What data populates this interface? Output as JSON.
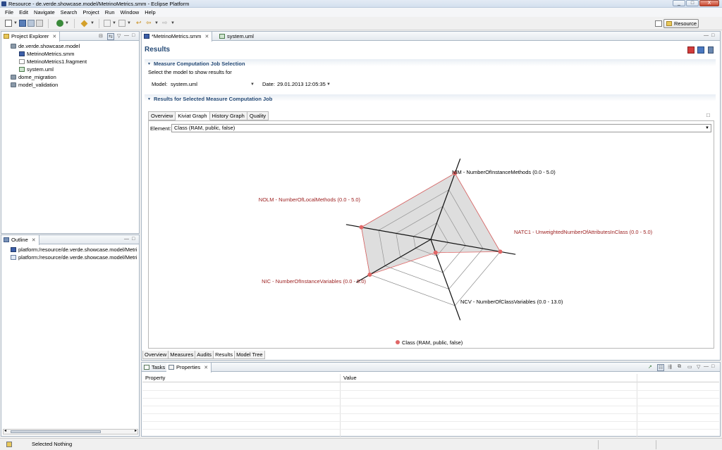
{
  "window": {
    "title": "Resource - de.verde.showcase.model/MetrinoMetrics.smm - Eclipse Platform",
    "buttons": [
      "_",
      "□",
      "X"
    ]
  },
  "menu": [
    "File",
    "Edit",
    "Navigate",
    "Search",
    "Project",
    "Run",
    "Window",
    "Help"
  ],
  "toolbar": {
    "perspective_label": "Resource"
  },
  "project_explorer": {
    "tab_label": "Project Explorer",
    "items": [
      {
        "label": "de.verde.showcase.model",
        "icon": "project-icon"
      },
      {
        "label": "MetrinoMetrics.smm",
        "icon": "smm-file-icon"
      },
      {
        "label": "MetrinoMetrics1.fragment",
        "icon": "file-icon"
      },
      {
        "label": "system.uml",
        "icon": "uml-file-icon"
      },
      {
        "label": "dome_migration",
        "icon": "project-icon"
      },
      {
        "label": "model_validation",
        "icon": "project-icon"
      }
    ]
  },
  "outline": {
    "tab_label": "Outline",
    "items": [
      {
        "label": "platform:/resource/de.verde.showcase.model/Metri"
      },
      {
        "label": "platform:/resource/de.verde.showcase.model/Metri"
      }
    ]
  },
  "editor": {
    "tabs": [
      {
        "label": "*MetrinoMetrics.smm",
        "active": true
      },
      {
        "label": "system.uml",
        "active": false
      }
    ],
    "page_title": "Results",
    "job_section": {
      "title": "Measure Computation Job Selection",
      "description": "Select the model to show results for",
      "model_label": "Model:",
      "model_value": "system.uml",
      "date_label": "Date:",
      "date_value": "29.01.2013 12:05:35"
    },
    "results_section": {
      "title": "Results for Selected Measure Computation Job",
      "tabs": [
        "Overview",
        "Kiviat Graph",
        "History Graph",
        "Quality"
      ],
      "active_tab": "Kiviat Graph",
      "element_label": "Element:",
      "element_value": "Class (RAM, public, false)"
    },
    "bottom_tabs": [
      "Overview",
      "Measures",
      "Audits",
      "Results",
      "Model Tree"
    ],
    "active_bottom_tab": "Results"
  },
  "chart_data": {
    "type": "radar",
    "axes": [
      {
        "label": "NIM - NumberOfInstanceMethods (0.0 - 5.0)",
        "min": 0.0,
        "max": 5.0,
        "color": "#000000"
      },
      {
        "label": "NATC1 - UnweightedNumberOfAttributesInClass (0.0 - 5.0)",
        "min": 0.0,
        "max": 5.0,
        "color": "#9b1c1c"
      },
      {
        "label": "NCV - NumberOfClassVariables (0.0 - 13.0)",
        "min": 0.0,
        "max": 13.0,
        "color": "#000000"
      },
      {
        "label": "NIC - NumberOfInstanceVariables (0.0 - 5.0)",
        "min": 0.0,
        "max": 5.0,
        "color": "#9b1c1c"
      },
      {
        "label": "NOLM - NumberOfLocalMethods (0.0 - 5.0)",
        "min": 0.0,
        "max": 5.0,
        "color": "#9b1c1c"
      }
    ],
    "series": [
      {
        "name": "Class (RAM, public, false)",
        "values": [
          5.0,
          5.0,
          2.6,
          5.0,
          5.0
        ],
        "color": "#e06666"
      }
    ],
    "rings": 4,
    "legend": "bottom"
  },
  "bottom_panel": {
    "tabs": [
      {
        "label": "Tasks",
        "active": false
      },
      {
        "label": "Properties",
        "active": true
      }
    ],
    "columns": [
      "Property",
      "Value"
    ]
  },
  "status": {
    "text": "Selected Nothing"
  }
}
